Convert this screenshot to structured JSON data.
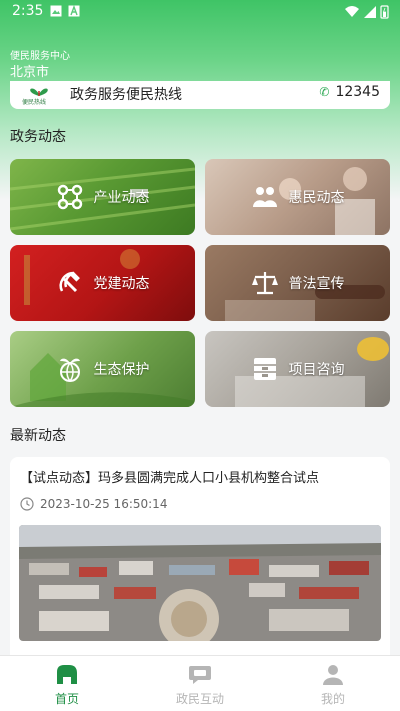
{
  "status_bar": {
    "time": "2:35"
  },
  "header": {
    "center_label": "便民服务中心",
    "city": "北京市"
  },
  "hotline": {
    "logo_text": "便民热线",
    "title": "政务服务便民热线",
    "phone": "12345"
  },
  "sections": {
    "news_category_title": "政务动态",
    "latest_title": "最新动态"
  },
  "tiles": [
    {
      "label": "产业动态",
      "icon": "network-nodes-icon"
    },
    {
      "label": "惠民动态",
      "icon": "people-icon"
    },
    {
      "label": "党建动态",
      "icon": "hammer-sickle-icon"
    },
    {
      "label": "普法宣传",
      "icon": "scales-icon"
    },
    {
      "label": "生态保护",
      "icon": "leaf-globe-icon"
    },
    {
      "label": "项目咨询",
      "icon": "cabinet-icon"
    }
  ],
  "news": {
    "title": "【试点动态】玛多县圆满完成人口小县机构整合试点",
    "time": "2023-10-25 16:50:14"
  },
  "tabbar": {
    "tabs": [
      {
        "label": "首页",
        "active": true
      },
      {
        "label": "政民互动",
        "active": false
      },
      {
        "label": "我的",
        "active": false
      }
    ]
  },
  "colors": {
    "accent": "#1f8f45",
    "inactive": "#b5b5b5"
  }
}
